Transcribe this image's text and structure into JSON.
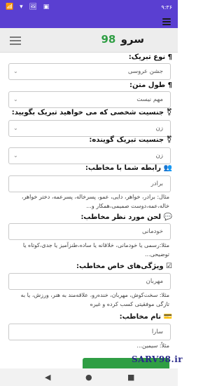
{
  "status": {
    "time": "۹:۳۶",
    "indicators": "📶 ▾ 🖼 ▣"
  },
  "app": {
    "logo_text": "سرو",
    "logo_num": "98"
  },
  "form": {
    "occasion": {
      "label": "¶ نوع تبریک:",
      "value": "جشن عروسی"
    },
    "length": {
      "label": "¶ طول متن:",
      "value": "مهم نیست"
    },
    "recipient_gender": {
      "label": "⚧ جنسیت شخصی که می خواهید تبریک بگویید:",
      "value": "زن"
    },
    "sender_gender": {
      "label": "⚧ جنسیت تبریک گوینده:",
      "value": "زن"
    },
    "relation": {
      "label": "👥 رابطه شما با مخاطب:",
      "value": "برادر",
      "hint": "مثال: برادر، خواهر، دایی، عمو، پسرخاله، پسرعمه، دختر خواهر، خاله،عمه،دوست صمیمی،همکار و..."
    },
    "tone": {
      "label": "💬 لحن مورد نظر مخاطب:",
      "value": "خودمانی",
      "hint": "مثلا:رسمی یا خودمانی، خلاقانه یا ساده،طنزآمیز یا جدی،کوتاه یا توضیحی..."
    },
    "traits": {
      "label": "☑ ویژگی‌های خاص مخاطب:",
      "value": "مهربان",
      "hint": "مثلا: سخت‌کوش، مهربان، خنده‌رو، علاقه‌مند به هنر، ورزش، یا به تازگی موفقیتی کسب کرده و غیره"
    },
    "name": {
      "label": "💳 نام مخاطب:",
      "value": "سارا",
      "hint": "مثلاً: سیمین..."
    }
  },
  "watermark": "SARV98.ir",
  "nav": {
    "back": "◀",
    "home": "●",
    "recents": "■"
  }
}
